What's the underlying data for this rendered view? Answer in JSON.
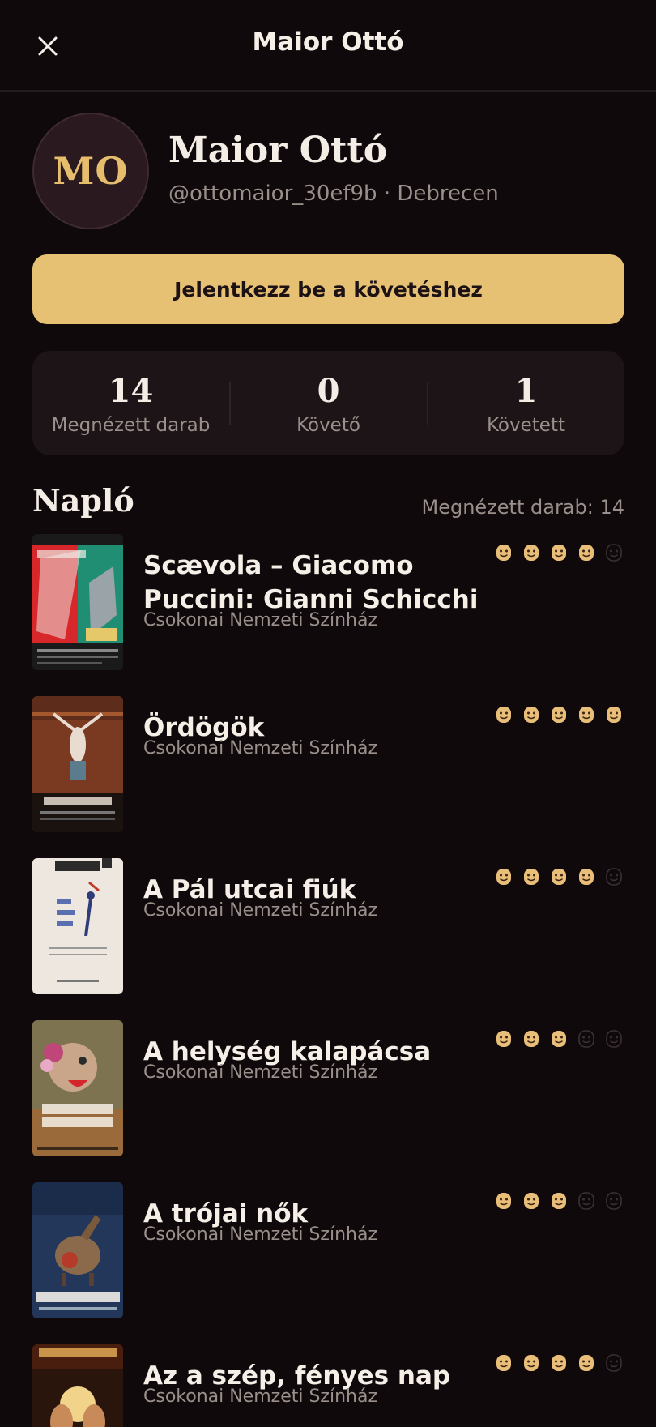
{
  "header": {
    "title": "Maior Ottó"
  },
  "profile": {
    "initials": "MO",
    "name": "Maior Ottó",
    "subtitle": "@ottomaior_30ef9b · Debrecen",
    "follow_button": "Jelentkezz be a követéshez"
  },
  "stats": [
    {
      "value": "14",
      "label": "Megnézett darab"
    },
    {
      "value": "0",
      "label": "Követő"
    },
    {
      "value": "1",
      "label": "Követett"
    }
  ],
  "diary": {
    "title": "Napló",
    "count_label": "Megnézett darab: 14",
    "entries": [
      {
        "title": "Scævola – Giacomo Puccini: Gianni Schicchi",
        "venue": "Csokonai Nemzeti Színház",
        "rating": 4,
        "max_rating": 5
      },
      {
        "title": "Ördögök",
        "venue": "Csokonai Nemzeti Színház",
        "rating": 5,
        "max_rating": 5
      },
      {
        "title": "A Pál utcai fiúk",
        "venue": "Csokonai Nemzeti Színház",
        "rating": 4,
        "max_rating": 5
      },
      {
        "title": "A helység kalapácsa",
        "venue": "Csokonai Nemzeti Színház",
        "rating": 3,
        "max_rating": 5
      },
      {
        "title": "A trójai nők",
        "venue": "Csokonai Nemzeti Színház",
        "rating": 3,
        "max_rating": 5
      },
      {
        "title": "Az a szép, fényes nap",
        "venue": "Csokonai Nemzeti Színház",
        "rating": 4,
        "max_rating": 5
      }
    ]
  },
  "colors": {
    "background": "#0f090b",
    "accent": "#e7c173",
    "rating_filled": "#e8be79",
    "rating_empty": "#3a3033",
    "muted_text": "#9a8f8a"
  },
  "icons": {
    "close": "close-icon",
    "rating": "smiley-face-icon"
  }
}
